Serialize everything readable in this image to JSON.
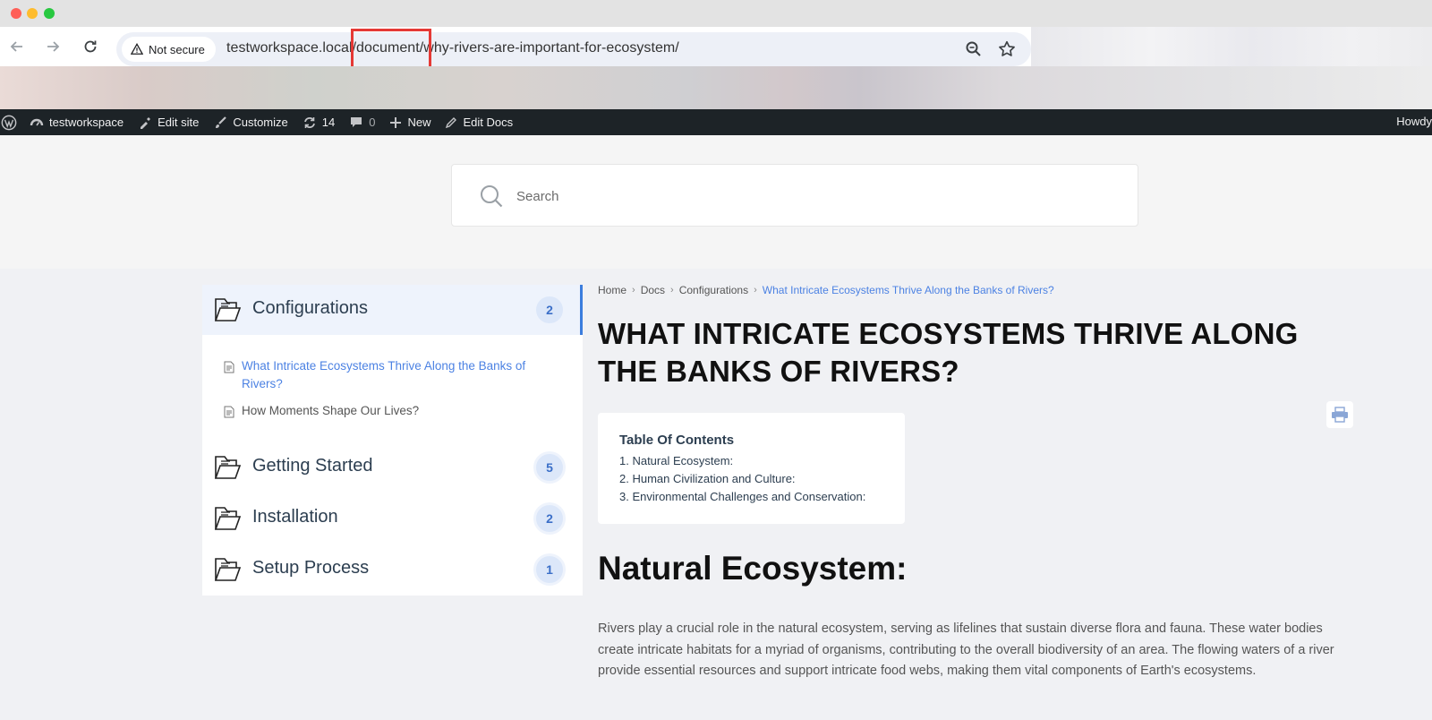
{
  "browser": {
    "security_label": "Not secure",
    "url": "testworkspace.local/document/why-rivers-are-important-for-ecosystem/"
  },
  "adminbar": {
    "site_name": "testworkspace",
    "edit_site": "Edit site",
    "customize": "Customize",
    "updates_count": "14",
    "comments_count": "0",
    "new": "New",
    "edit_docs": "Edit Docs",
    "right_text": "Howdy"
  },
  "search": {
    "placeholder": "Search"
  },
  "sidebar": {
    "categories": [
      {
        "label": "Configurations",
        "count": "2"
      },
      {
        "label": "Getting Started",
        "count": "5"
      },
      {
        "label": "Installation",
        "count": "2"
      },
      {
        "label": "Setup Process",
        "count": "1"
      }
    ],
    "docs": [
      {
        "label": "What Intricate Ecosystems Thrive Along the Banks of Rivers?"
      },
      {
        "label": "How Moments Shape Our Lives?"
      }
    ]
  },
  "breadcrumb": {
    "home": "Home",
    "docs": "Docs",
    "configurations": "Configurations",
    "current": "What Intricate Ecosystems Thrive Along the Banks of Rivers?"
  },
  "article": {
    "title": "WHAT INTRICATE ECOSYSTEMS THRIVE ALONG THE BANKS OF RIVERS?",
    "toc_title": "Table Of Contents",
    "toc_items": [
      "1. Natural Ecosystem:",
      "2. Human Civilization and Culture:",
      "3. Environmental Challenges and Conservation:"
    ],
    "section_heading": "Natural Ecosystem:",
    "paragraph": "Rivers play a crucial role in the natural ecosystem, serving as lifelines that sustain diverse flora and fauna. These water bodies create intricate habitats for a myriad of organisms, contributing to the overall biodiversity of an area. The flowing waters of a river provide essential resources and support intricate food webs, making them vital components of Earth's ecosystems."
  },
  "colors": {
    "accent": "#3b7ddd",
    "link": "#4c82e3",
    "adminbar": "#1d2327",
    "highlight_box": "#e53935"
  }
}
